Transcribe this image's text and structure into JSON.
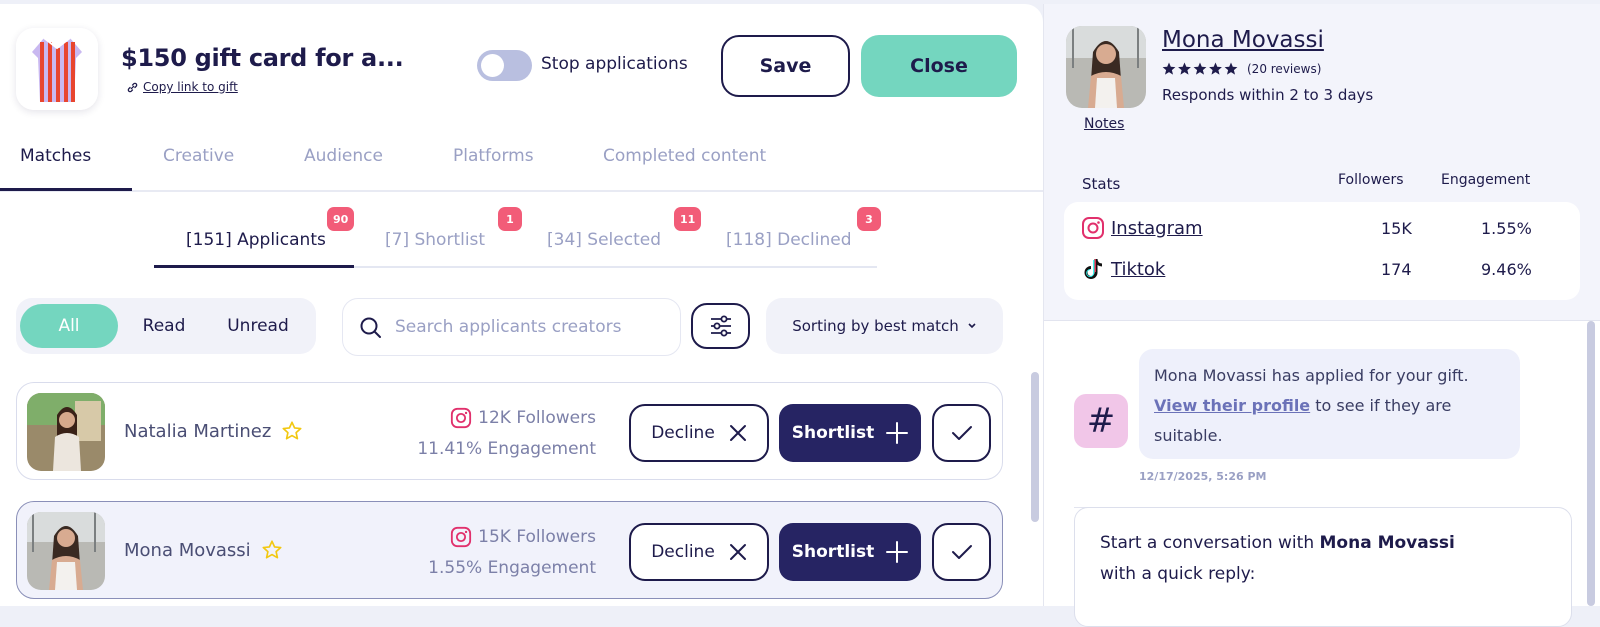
{
  "gift": {
    "title": "$150 gift card for a...",
    "copy_link": "Copy link to gift"
  },
  "header": {
    "toggle_label": "Stop applications",
    "save_label": "Save",
    "close_label": "Close"
  },
  "main_tabs": [
    "Matches",
    "Creative",
    "Audience",
    "Platforms",
    "Completed content"
  ],
  "sub_tabs": [
    {
      "label": "[151] Applicants",
      "badge": "90"
    },
    {
      "label": "[7] Shortlist",
      "badge": "1"
    },
    {
      "label": "[34] Selected",
      "badge": "11"
    },
    {
      "label": "[118] Declined",
      "badge": "3"
    }
  ],
  "filters": {
    "segments": [
      "All",
      "Read",
      "Unread"
    ],
    "search_placeholder": "Search applicants creators",
    "sort_label": "Sorting by best match"
  },
  "applicants": [
    {
      "name": "Natalia Martinez",
      "followers": "12K Followers",
      "engagement": "11.41% Engagement",
      "decline": "Decline",
      "shortlist": "Shortlist"
    },
    {
      "name": "Mona Movassi",
      "followers": "15K Followers",
      "engagement": "1.55% Engagement",
      "decline": "Decline",
      "shortlist": "Shortlist"
    }
  ],
  "profile": {
    "name": "Mona Movassi",
    "reviews": "(20 reviews)",
    "rating": 5,
    "responds": "Responds within 2 to 3 days",
    "notes": "Notes"
  },
  "stats": {
    "title": "Stats",
    "col_followers": "Followers",
    "col_engagement": "Engagement",
    "rows": [
      {
        "platform": "Instagram",
        "followers": "15K",
        "engagement": "1.55%"
      },
      {
        "platform": "Tiktok",
        "followers": "174",
        "engagement": "9.46%"
      }
    ]
  },
  "chat": {
    "msg_before": "Mona Movassi has applied for your gift.",
    "msg_link": "View their profile",
    "msg_after": "to see if they are suitable.",
    "timestamp": "12/17/2025, 5:26 PM",
    "quick_prefix": "Start a conversation with",
    "quick_name": "Mona Movassi",
    "quick_suffix": "with a quick reply:"
  },
  "colors": {
    "primary": "#1e1b4b",
    "accent_green": "#74d6bf",
    "shortlist_bg": "#262463",
    "badge_red": "#f25c78",
    "instagram": "#e1306c"
  }
}
